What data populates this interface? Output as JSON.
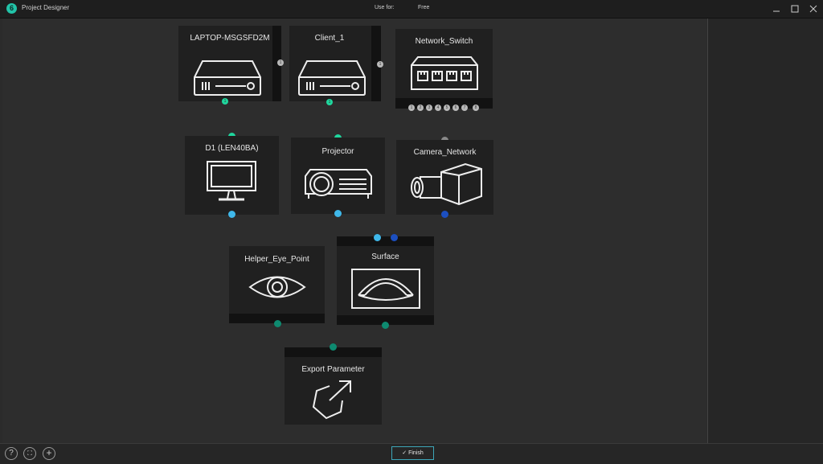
{
  "titlebar": {
    "logo_glyph": "6",
    "app_title": "Project Designer",
    "use_for_label": "Use for:",
    "use_for_value": "Free",
    "controls": [
      "minimize-icon",
      "maximize-icon",
      "close-icon"
    ]
  },
  "colors": {
    "accent_green": "#1fd69d",
    "accent_cyan": "#3fb8ea",
    "accent_blue": "#1c4fc0",
    "accent_teal": "#0e8a70",
    "port_gray": "#8a8a8a"
  },
  "nodes": {
    "laptop": {
      "title": "LAPTOP-MSGSFD2M",
      "icon": "server-box-icon",
      "port_badge": "1",
      "out_badge": "1"
    },
    "client": {
      "title": "Client_1",
      "icon": "server-box-icon",
      "port_badge": "1",
      "out_badge": "1"
    },
    "switch": {
      "title": "Network_Switch",
      "icon": "network-switch-icon",
      "ports": [
        "1",
        "2",
        "3",
        "4",
        "5",
        "6",
        "7",
        "8"
      ]
    },
    "display": {
      "title": "D1  (LEN40BA)",
      "icon": "monitor-icon"
    },
    "projector": {
      "title": "Projector",
      "icon": "projector-icon"
    },
    "camera": {
      "title": "Camera_Network",
      "icon": "camera-icon"
    },
    "eye": {
      "title": "Helper_Eye_Point",
      "icon": "eye-icon"
    },
    "surface": {
      "title": "Surface",
      "icon": "surface-icon"
    },
    "export": {
      "title": "Export Parameter",
      "icon": "export-icon"
    }
  },
  "bottombar": {
    "help_glyph": "?",
    "fit_glyph": "⛶",
    "add_glyph": "+",
    "finish_label": "Finish"
  }
}
